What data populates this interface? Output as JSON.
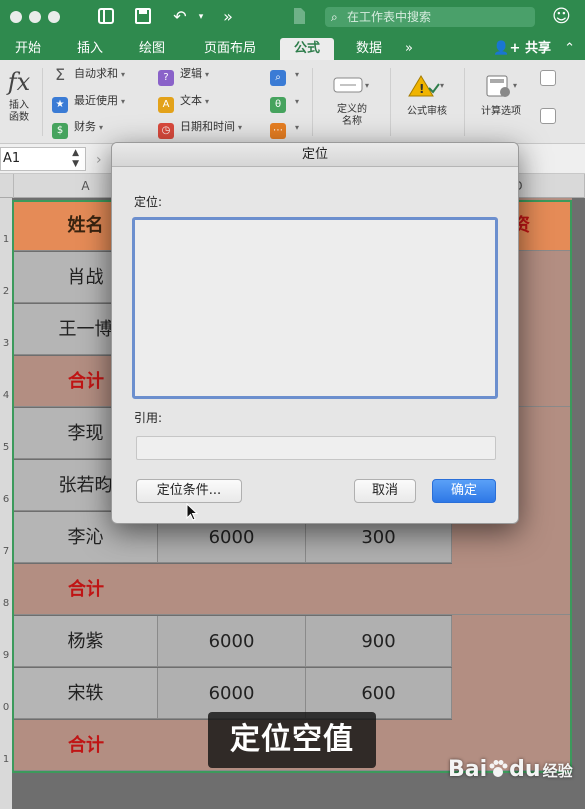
{
  "titlebar": {
    "search_placeholder": "在工作表中搜索",
    "icons": [
      "sidebar-icon",
      "save-icon",
      "undo-icon",
      "more-icon",
      "file-icon",
      "search-icon",
      "smiley-icon"
    ]
  },
  "tabs": [
    {
      "label": "开始",
      "active": false
    },
    {
      "label": "插入",
      "active": false
    },
    {
      "label": "绘图",
      "active": false
    },
    {
      "label": "页面布局",
      "active": false
    },
    {
      "label": "公式",
      "active": true
    },
    {
      "label": "数据",
      "active": false
    }
  ],
  "tabs_more": "»",
  "share_label": "共享",
  "ribbon": {
    "insert_function": {
      "icon": "fx",
      "label": "插入\n函数"
    },
    "autosum": "自动求和",
    "recent": "最近使用",
    "financial": "财务",
    "logical": "逻辑",
    "text": "文本",
    "datetime": "日期和时间",
    "defined_names": "定义的\n名称",
    "formula_audit": "公式审核",
    "calc_options": "计算选项"
  },
  "formula_bar": {
    "namebox": "A1"
  },
  "sheet": {
    "columns": [
      "A",
      "D"
    ],
    "row_numbers": [
      "1",
      "2",
      "3",
      "4",
      "5",
      "6",
      "7",
      "8",
      "9",
      "0",
      "1"
    ],
    "header": {
      "name": "姓名",
      "salary": "资"
    },
    "rows": [
      {
        "name": "肖战",
        "b": "",
        "c": ""
      },
      {
        "name": "王一博",
        "b": "",
        "c": ""
      },
      {
        "name": "合计",
        "sum": true
      },
      {
        "name": "李现",
        "b": "",
        "c": ""
      },
      {
        "name": "张若昀",
        "b": "",
        "c": ""
      },
      {
        "name": "李沁",
        "b": "6000",
        "c": "300"
      },
      {
        "name": "合计",
        "sum": true
      },
      {
        "name": "杨紫",
        "b": "6000",
        "c": "900"
      },
      {
        "name": "宋轶",
        "b": "6000",
        "c": "600"
      },
      {
        "name": "合计",
        "sum": true
      }
    ]
  },
  "dialog": {
    "title": "定位",
    "goto_label": "定位:",
    "ref_label": "引用:",
    "special_button": "定位条件...",
    "cancel_button": "取消",
    "ok_button": "确定"
  },
  "caption": "定位空值",
  "watermark": {
    "brand": "Bai",
    "brand2": "du",
    "sub": "经验"
  },
  "colors": {
    "accent_green": "#2f8a4e",
    "header_orange": "#e58b57",
    "sum_band": "#b38e82",
    "sum_text": "#c01414",
    "ok_blue": "#2e78e6"
  }
}
